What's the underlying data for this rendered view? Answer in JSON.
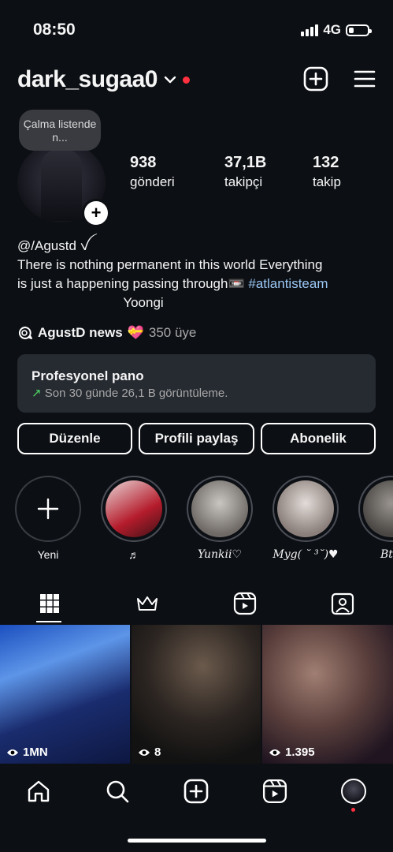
{
  "status_bar": {
    "time": "08:50",
    "network": "4G",
    "battery_level": 0.25
  },
  "header": {
    "username": "dark_sugaa0"
  },
  "note": {
    "text": "Çalma listende n..."
  },
  "stats": [
    {
      "value": "938",
      "label": "gönderi"
    },
    {
      "value": "37,1B",
      "label": "takipçi"
    },
    {
      "value": "132",
      "label": "takip"
    }
  ],
  "bio": {
    "handle": "@/Agustd ꪜ",
    "line1": "There is nothing permanent in this world Everything",
    "line2": "is just a happening passing through",
    "emoji": "📼",
    "hashtag": "#atlantisteam",
    "line3": "Yoongi"
  },
  "channel": {
    "name": "AgustD news",
    "emoji": "💝",
    "members": "350 üye"
  },
  "dashboard": {
    "title": "Profesyonel pano",
    "subtitle": "Son 30 günde 26,1 B görüntüleme."
  },
  "buttons": {
    "edit": "Düzenle",
    "share": "Profili paylaş",
    "subscribe": "Abonelik"
  },
  "highlights": [
    {
      "label": "Yeni"
    },
    {
      "label": "♬"
    },
    {
      "label": "Yunkii♡"
    },
    {
      "label": "Myg( ˘ ³˘)♥"
    },
    {
      "label": "Bt"
    }
  ],
  "posts": [
    {
      "views": "1MN"
    },
    {
      "views": "8"
    },
    {
      "views": "1.395"
    }
  ],
  "colors": {
    "background": "#0c0f14",
    "accent_link": "#9cc8f5",
    "notification": "#ff3040",
    "card": "#262a31"
  }
}
